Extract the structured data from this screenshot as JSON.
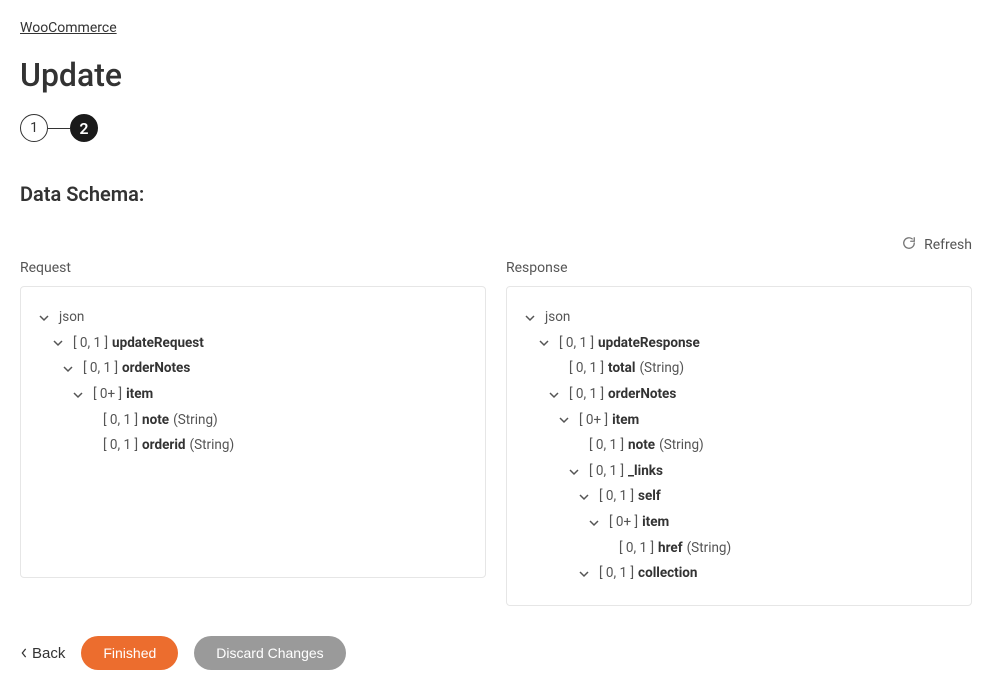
{
  "breadcrumb": {
    "label": "WooCommerce"
  },
  "page": {
    "title": "Update"
  },
  "stepper": {
    "steps": [
      "1",
      "2"
    ],
    "active_index": 1
  },
  "section": {
    "title": "Data Schema:"
  },
  "refresh": {
    "label": "Refresh"
  },
  "columns": {
    "request": {
      "label": "Request",
      "tree": {
        "root": "json",
        "updateRequest": {
          "card": "[ 0, 1 ]",
          "name": "updateRequest"
        },
        "orderNotes": {
          "card": "[ 0, 1 ]",
          "name": "orderNotes"
        },
        "item": {
          "card": "[ 0+ ]",
          "name": "item"
        },
        "note": {
          "card": "[ 0, 1 ]",
          "name": "note",
          "type": "(String)"
        },
        "orderid": {
          "card": "[ 0, 1 ]",
          "name": "orderid",
          "type": "(String)"
        }
      }
    },
    "response": {
      "label": "Response",
      "tree": {
        "root": "json",
        "updateResponse": {
          "card": "[ 0, 1 ]",
          "name": "updateResponse"
        },
        "total": {
          "card": "[ 0, 1 ]",
          "name": "total",
          "type": "(String)"
        },
        "orderNotes": {
          "card": "[ 0, 1 ]",
          "name": "orderNotes"
        },
        "item": {
          "card": "[ 0+ ]",
          "name": "item"
        },
        "note": {
          "card": "[ 0, 1 ]",
          "name": "note",
          "type": "(String)"
        },
        "links": {
          "card": "[ 0, 1 ]",
          "name": "_links"
        },
        "self": {
          "card": "[ 0, 1 ]",
          "name": "self"
        },
        "selfItem": {
          "card": "[ 0+ ]",
          "name": "item"
        },
        "href": {
          "card": "[ 0, 1 ]",
          "name": "href",
          "type": "(String)"
        },
        "collection": {
          "card": "[ 0, 1 ]",
          "name": "collection"
        }
      }
    }
  },
  "footer": {
    "back": "Back",
    "finished": "Finished",
    "discard": "Discard Changes"
  }
}
